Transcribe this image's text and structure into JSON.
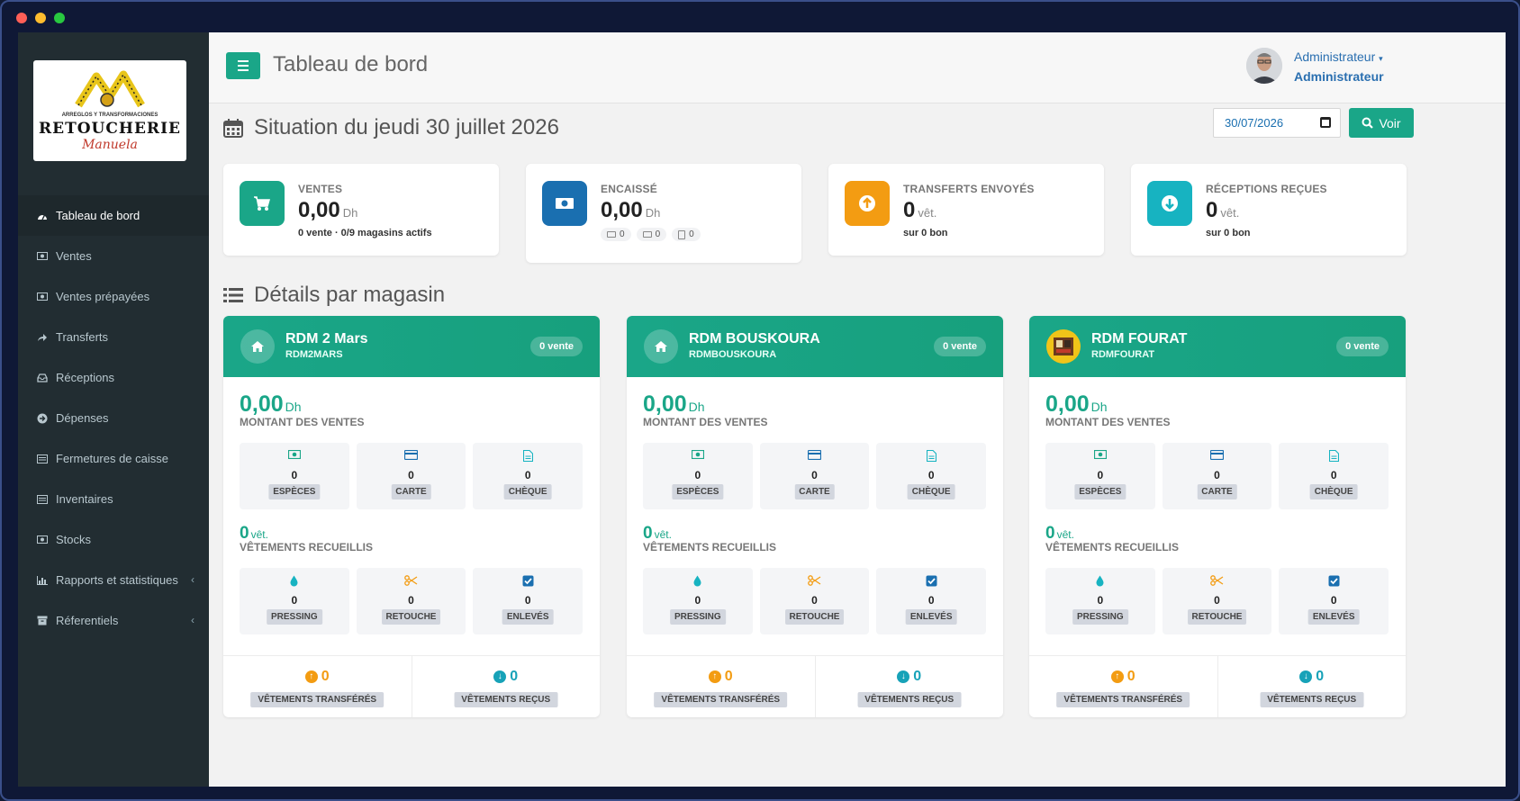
{
  "header": {
    "page_title": "Tableau de bord",
    "user_name": "Administrateur",
    "user_role": "Administrateur"
  },
  "logo": {
    "text": "RETOUCHERIE",
    "tagline": "ARREGLOS Y TRANSFORMACIONES",
    "signature": "Manuela"
  },
  "sidebar": {
    "items": [
      {
        "label": "Tableau de bord",
        "icon": "dashboard-icon",
        "active": true
      },
      {
        "label": "Ventes",
        "icon": "money-icon"
      },
      {
        "label": "Ventes prépayées",
        "icon": "money-icon"
      },
      {
        "label": "Transferts",
        "icon": "share-icon"
      },
      {
        "label": "Réceptions",
        "icon": "inbox-icon"
      },
      {
        "label": "Dépenses",
        "icon": "arrow-circle-icon"
      },
      {
        "label": "Fermetures de caisse",
        "icon": "list-icon"
      },
      {
        "label": "Inventaires",
        "icon": "list-icon"
      },
      {
        "label": "Stocks",
        "icon": "money-icon"
      },
      {
        "label": "Rapports et statistiques",
        "icon": "bar-chart-icon",
        "chevron": true
      },
      {
        "label": "Réferentiels",
        "icon": "archive-icon",
        "chevron": true
      }
    ]
  },
  "situation": {
    "title": "Situation du jeudi 30 juillet 2026",
    "date_value": "30/07/2026",
    "voir_label": "Voir"
  },
  "stats": {
    "ventes": {
      "label": "VENTES",
      "value": "0,00",
      "unit": "Dh",
      "sub": "0 vente · 0/9 magasins actifs"
    },
    "encaisse": {
      "label": "ENCAISSÉ",
      "value": "0,00",
      "unit": "Dh",
      "especes": "0",
      "carte": "0",
      "cheque": "0"
    },
    "transferts": {
      "label": "TRANSFERTS ENVOYÉS",
      "value": "0",
      "unit": "vêt.",
      "sub": "sur 0 bon"
    },
    "receptions": {
      "label": "RÉCEPTIONS REÇUES",
      "value": "0",
      "unit": "vêt.",
      "sub": "sur 0 bon"
    }
  },
  "details_title": "Détails par magasin",
  "labels": {
    "montant": "MONTANT DES VENTES",
    "vetements": "VÊTEMENTS RECUEILLIS",
    "especes": "ESPÈCES",
    "carte": "CARTE",
    "cheque": "CHÈQUE",
    "pressing": "PRESSING",
    "retouche": "RETOUCHE",
    "enleves": "ENLEVÉS",
    "transferes": "VÊTEMENTS TRANSFÉRÉS",
    "recus": "VÊTEMENTS REÇUS",
    "dh": "Dh",
    "vet": "vêt."
  },
  "stores": [
    {
      "name": "RDM 2 Mars",
      "code": "RDM2MARS",
      "badge": "0 vente",
      "amount": "0,00",
      "especes": "0",
      "carte": "0",
      "cheque": "0",
      "vetements": "0",
      "pressing": "0",
      "retouche": "0",
      "enleves": "0",
      "transferes": "0",
      "recus": "0",
      "avatar": "home-icon"
    },
    {
      "name": "RDM BOUSKOURA",
      "code": "RDMBOUSKOURA",
      "badge": "0 vente",
      "amount": "0,00",
      "especes": "0",
      "carte": "0",
      "cheque": "0",
      "vetements": "0",
      "pressing": "0",
      "retouche": "0",
      "enleves": "0",
      "transferes": "0",
      "recus": "0",
      "avatar": "home-icon"
    },
    {
      "name": "RDM FOURAT",
      "code": "RDMFOURAT",
      "badge": "0 vente",
      "amount": "0,00",
      "especes": "0",
      "carte": "0",
      "cheque": "0",
      "vetements": "0",
      "pressing": "0",
      "retouche": "0",
      "enleves": "0",
      "transferes": "0",
      "recus": "0",
      "avatar": "store-photo"
    }
  ],
  "colors": {
    "accent": "#1aa688",
    "blue": "#1a6fb0",
    "orange": "#f39c12",
    "teal": "#17b3c1",
    "sidebar": "#222d32"
  }
}
